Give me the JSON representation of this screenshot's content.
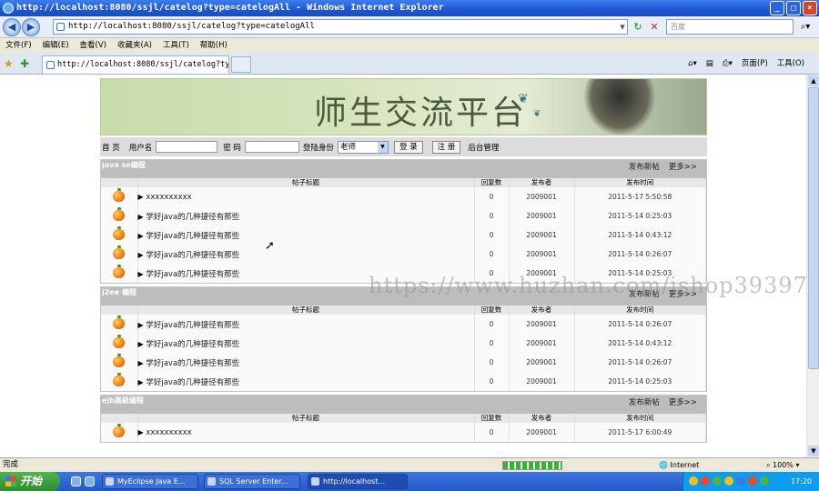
{
  "window": {
    "title": "http://localhost:8080/ssjl/catelog?type=catelogAll - Windows Internet Explorer"
  },
  "address": {
    "url": "http://localhost:8080/ssjl/catelog?type=catelogAll",
    "search_placeholder": "百度"
  },
  "menu": [
    "文件(F)",
    "编辑(E)",
    "查看(V)",
    "收藏夹(A)",
    "工具(T)",
    "帮助(H)"
  ],
  "tab": {
    "label": "http://localhost:8080/ssjl/catelog?type=c..."
  },
  "toolbar_right": {
    "page": "页面(P)",
    "tools": "工具(O)"
  },
  "site": {
    "title": "师生交流平台",
    "login": {
      "home": "首 页",
      "username_label": "用户名",
      "password_label": "密 码",
      "role_label": "登陆身份",
      "role_value": "老师",
      "login_button": "登 录",
      "register_button": "注 册",
      "admin_link": "后台管理"
    },
    "columns": [
      "帖子标题",
      "回复数",
      "发布者",
      "发布时间"
    ],
    "post_new": "发布新帖",
    "more": "更多>>",
    "sections": [
      {
        "name": "java se编程",
        "rows": [
          {
            "title": "xxxxxxxxxx",
            "replies": "0",
            "author": "2009001",
            "time": "2011-5-17 5:50:58"
          },
          {
            "title": "学好java的几种捷径有那些",
            "replies": "0",
            "author": "2009001",
            "time": "2011-5-14 0:25:03"
          },
          {
            "title": "学好java的几种捷径有那些",
            "replies": "0",
            "author": "2009001",
            "time": "2011-5-14 0:43:12"
          },
          {
            "title": "学好java的几种捷径有那些",
            "replies": "0",
            "author": "2009001",
            "time": "2011-5-14 0:26:07"
          },
          {
            "title": "学好java的几种捷径有那些",
            "replies": "0",
            "author": "2009001",
            "time": "2011-5-14 0:25:03"
          }
        ]
      },
      {
        "name": "j2ee 编程",
        "rows": [
          {
            "title": "学好java的几种捷径有那些",
            "replies": "0",
            "author": "2009001",
            "time": "2011-5-14 0:26:07"
          },
          {
            "title": "学好java的几种捷径有那些",
            "replies": "0",
            "author": "2009001",
            "time": "2011-5-14 0:43:12"
          },
          {
            "title": "学好java的几种捷径有那些",
            "replies": "0",
            "author": "2009001",
            "time": "2011-5-14 0:26:07"
          },
          {
            "title": "学好java的几种捷径有那些",
            "replies": "0",
            "author": "2009001",
            "time": "2011-5-14 0:25:03"
          }
        ]
      },
      {
        "name": "ejb高级编程",
        "rows": [
          {
            "title": "xxxxxxxxxx",
            "replies": "0",
            "author": "2009001",
            "time": "2011-5-17 6:00:49"
          }
        ]
      }
    ]
  },
  "watermark": "https://www.huzhan.com/ishop39397",
  "status": {
    "text": "完成",
    "zone": "Internet",
    "zoom": "100%"
  },
  "taskbar": {
    "start": "开始",
    "tasks": [
      "MyEclipse Java E...",
      "SQL Server Enter...",
      "http://localhost..."
    ],
    "clock": "17:20"
  }
}
